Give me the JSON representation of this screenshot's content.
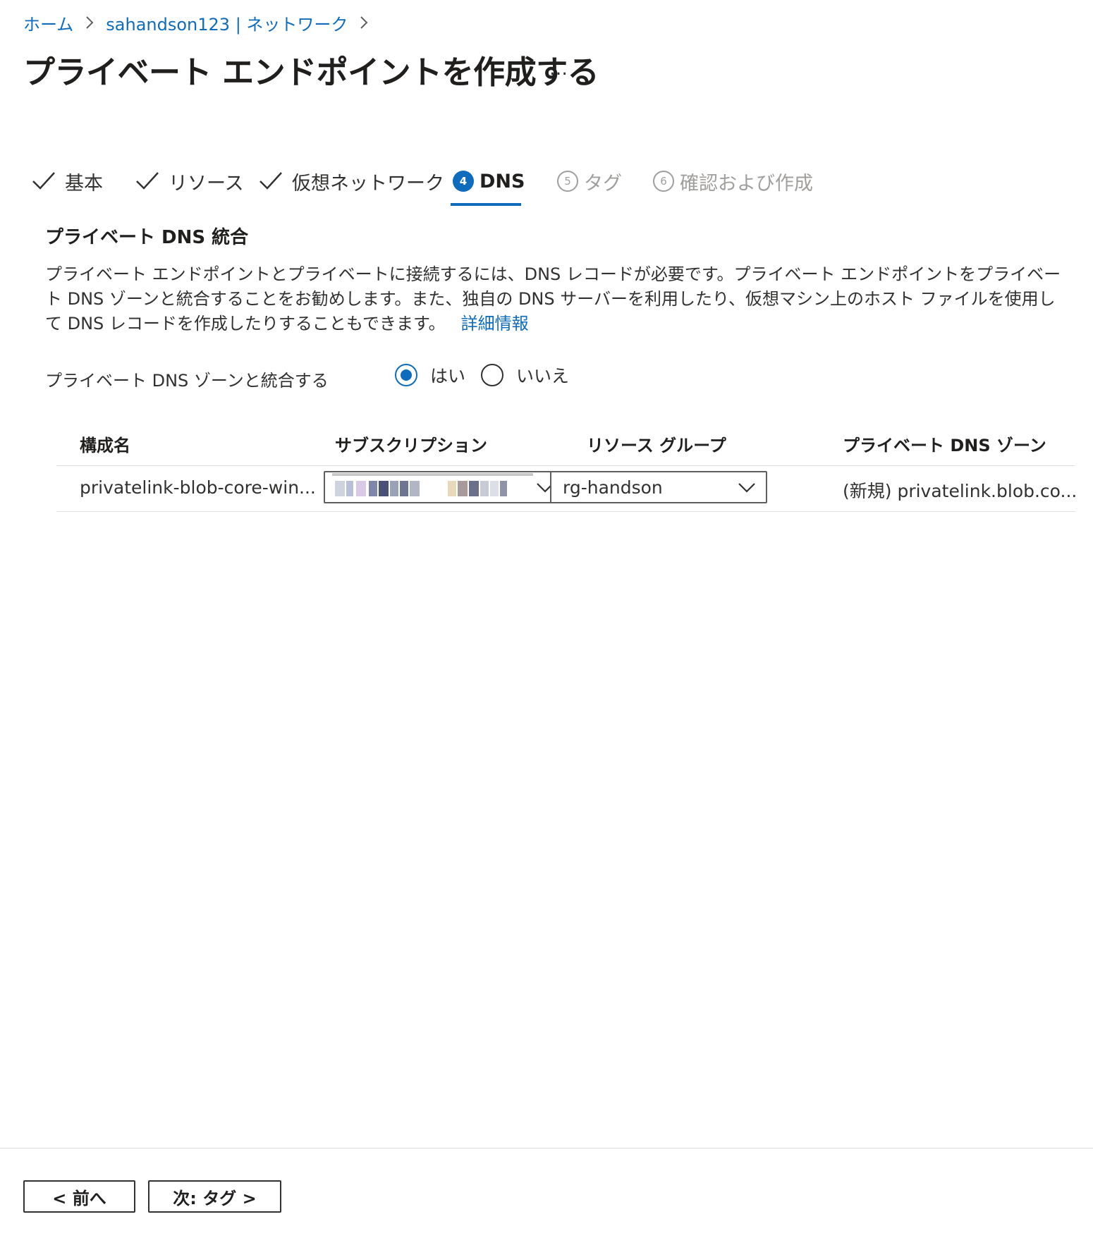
{
  "breadcrumb": {
    "home": "ホーム",
    "parent": "sahandson123 | ネットワーク"
  },
  "page": {
    "title": "プライベート エンドポイントを作成する",
    "more": "…"
  },
  "steps": [
    {
      "label": "基本",
      "state": "done"
    },
    {
      "label": "リソース",
      "state": "done"
    },
    {
      "label": "仮想ネットワーク",
      "state": "done"
    },
    {
      "number": "4",
      "label": "DNS",
      "state": "active"
    },
    {
      "number": "5",
      "label": "タグ",
      "state": "pending"
    },
    {
      "number": "6",
      "label": "確認および作成",
      "state": "pending"
    }
  ],
  "section": {
    "title": "プライベート DNS 統合",
    "description": "プライベート エンドポイントとプライベートに接続するには、DNS レコードが必要です。プライベート エンドポイントをプライベート DNS ゾーンと統合することをお勧めします。また、独自の DNS サーバーを利用したり、仮想マシン上のホスト ファイルを使用して DNS レコードを作成したりすることもできます。",
    "learn_more": "詳細情報"
  },
  "integrate": {
    "label": "プライベート DNS ゾーンと統合する",
    "options": [
      "はい",
      "いいえ"
    ],
    "selected": "はい"
  },
  "table": {
    "headers": [
      "構成名",
      "サブスクリプション",
      "リソース グループ",
      "プライベート DNS ゾーン"
    ],
    "rows": [
      {
        "config_name": "privatelink-blob-core-win...",
        "subscription": "",
        "resource_group": "rg-handson",
        "dns_zone": "(新規) privatelink.blob.co..."
      }
    ]
  },
  "footer": {
    "prev": "< 前へ",
    "next": "次: タグ >"
  },
  "colors": {
    "accent": "#0f6cbd",
    "text": "#323130",
    "muted": "#a19f9d"
  }
}
